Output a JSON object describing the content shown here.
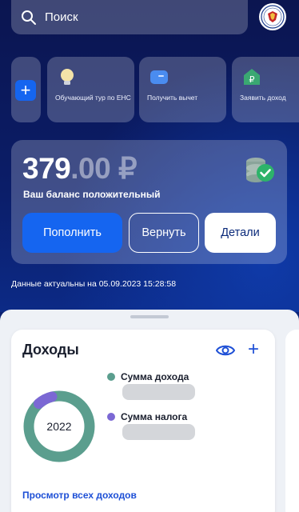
{
  "search": {
    "placeholder": "Поиск"
  },
  "quick_actions": [
    {
      "id": "add",
      "icon": "plus-icon",
      "label": ""
    },
    {
      "id": "tour",
      "icon": "lightbulb-icon",
      "label": "Обучающий тур по ЕНС"
    },
    {
      "id": "deduction",
      "icon": "wallet-icon",
      "label": "Получить вычет"
    },
    {
      "id": "claim",
      "icon": "ruble-house-icon",
      "label": "Заявить доход"
    }
  ],
  "balance": {
    "amount_int": "379",
    "amount_dec": ".00 ₽",
    "status": "Ваш баланс положительный",
    "buttons": {
      "topup": "Пополнить",
      "return": "Вернуть",
      "details": "Детали"
    },
    "updated": "Данные актуальны на 05.09.2023 15:28:58"
  },
  "income": {
    "title": "Доходы",
    "year": "2022",
    "legend": [
      {
        "label": "Сумма дохода",
        "color": "#5b9e8e"
      },
      {
        "label": "Сумма налога",
        "color": "#7b68d4"
      }
    ],
    "view_all": "Просмотр всех доходов"
  },
  "colors": {
    "accent": "#1565f0",
    "income": "#5b9e8e",
    "tax": "#7b68d4"
  }
}
